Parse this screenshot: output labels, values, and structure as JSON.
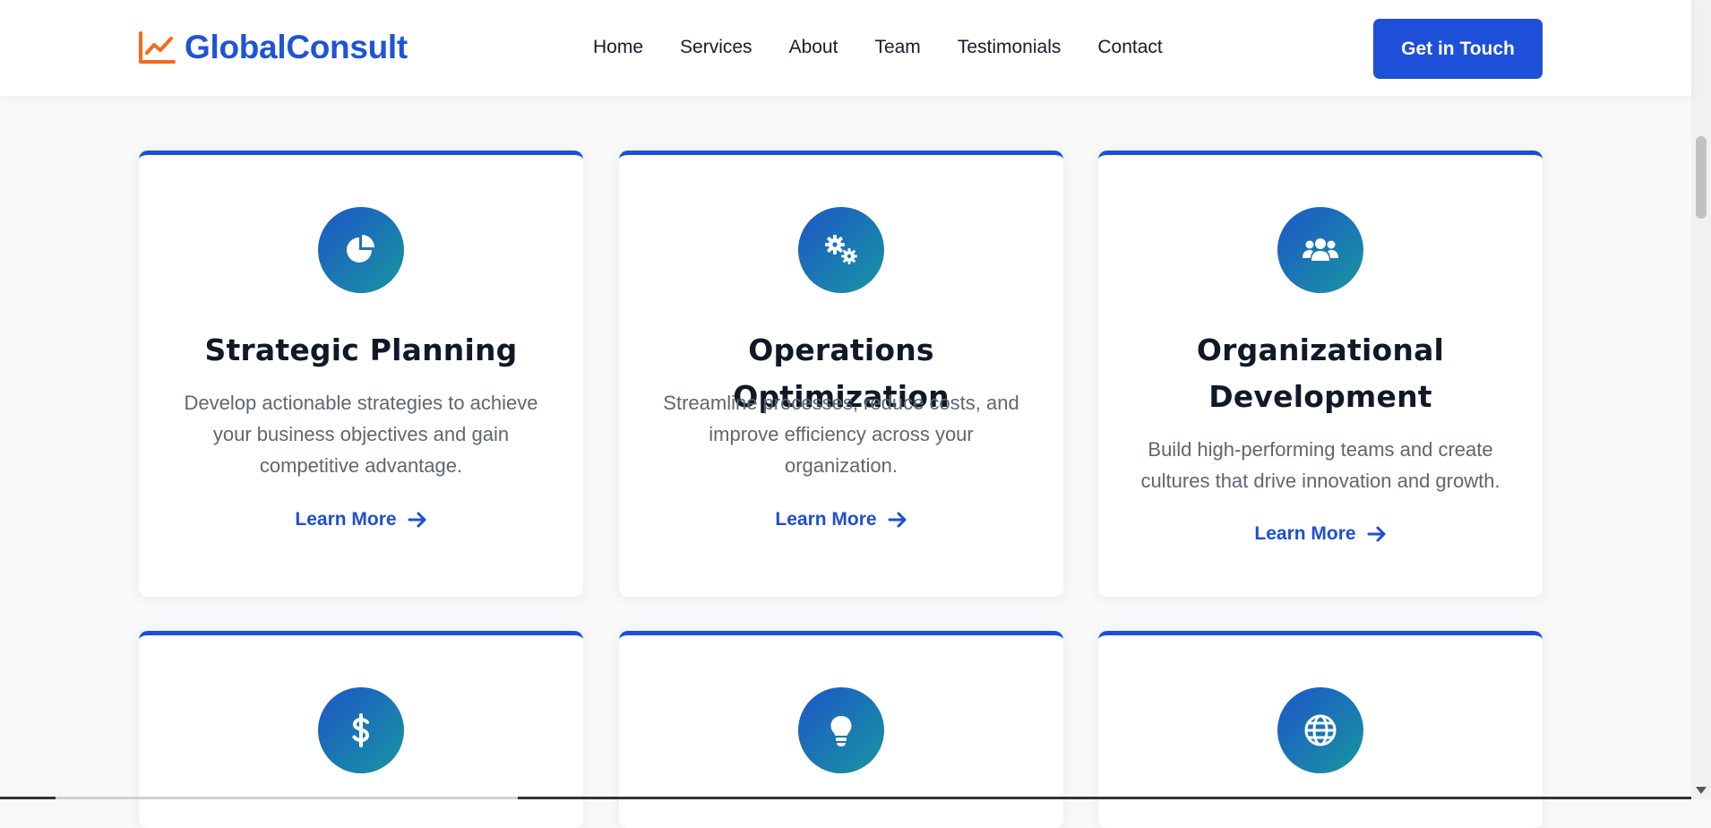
{
  "brand": {
    "name": "GlobalConsult",
    "icon": "chart-line-icon",
    "icon_color": "#f26b1d",
    "color": "#1e55d6"
  },
  "nav": [
    {
      "label": "Home"
    },
    {
      "label": "Services"
    },
    {
      "label": "About"
    },
    {
      "label": "Team"
    },
    {
      "label": "Testimonials"
    },
    {
      "label": "Contact"
    }
  ],
  "cta": {
    "label": "Get in Touch",
    "color": "#1d4fd8"
  },
  "services": [
    {
      "icon": "pie-chart-icon",
      "title": "Strategic Planning",
      "description": "Develop actionable strategies to achieve your business objectives and gain competitive advantage.",
      "link": "Learn More"
    },
    {
      "icon": "gears-icon",
      "title": "Operations Optimization",
      "description": "Streamline processes, reduce costs, and improve efficiency across your organization.",
      "link": "Learn More"
    },
    {
      "icon": "users-icon",
      "title": "Organizational Development",
      "description": "Build high-performing teams and create cultures that drive innovation and growth.",
      "link": "Learn More"
    },
    {
      "icon": "dollar-icon"
    },
    {
      "icon": "lightbulb-icon"
    },
    {
      "icon": "globe-icon"
    }
  ],
  "colors": {
    "accent": "#1e4fd2",
    "icon_gradient_start": "#1e56c8",
    "icon_gradient_end": "#1796a0"
  }
}
